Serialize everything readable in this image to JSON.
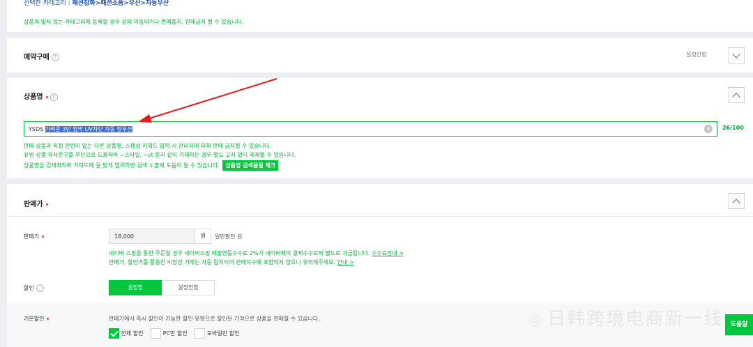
{
  "category": {
    "label": "선택한 카테고리 :",
    "path": "패션잡화>패션소품>우산>자동우산",
    "notice": "상품과 맞지 않는 카테고리에 등록할 경우 강제 이동되거나 판매중지, 판매금지 될 수 있습니다."
  },
  "reservation": {
    "title": "예약구매",
    "status": "설정안함"
  },
  "product_name": {
    "title": "상품명",
    "prefix": "YSDS",
    "highlighted": "가벼운 3단 암막 UV차단 자동 양우산",
    "counter": "26/100",
    "help1": "판매 상품과 직접 관련이 없는 다른 상품명, 스팸성 키워드 입력 시 관리자에 의해 판매 금지될 수 있습니다.",
    "help2": "유명 상품 유사문구를 무단으로 도용하여 ~스타일, ~st 등과 같이 기재하는 경우 별도 고지 없이 제재될 수 있습니다.",
    "help3": "상품명을 검색최적화 가이드에 잘 맞게 입력하면 검색 노출에 도움이 될 수 있습니다.",
    "check_button": "상품명 검색품질 체크"
  },
  "price": {
    "title": "판매가",
    "row_label": "판매가",
    "value": "18,000",
    "unit": "원",
    "reading": "일만팔천 원",
    "note1": "네이버 쇼핑을 통한 주문일 경우 네이버쇼핑 매출연동수수료 2%가 네이버페이 결제수수료와 별도로 과금됩니다.",
    "note1_link": "수수료안내 >",
    "note2": "판매가, 할인가를 활용한 비정상 거래는 자동 탐지되어 판매지수에 포함되지 않으니 유의해주세요.",
    "note2_link": "안내 >",
    "discount_label": "할인",
    "discount_on": "설정함",
    "discount_off": "설정안함",
    "base_discount_label": "기본할인",
    "base_discount_note": "판매가에서 즉시 할인이 가능한 할인 유형으로 할인된 가격으로 상품을 판매할 수 있습니다.",
    "options": [
      "전체 할인",
      "PC만 할인",
      "모바일만 할인"
    ]
  },
  "watermark": "日韩跨境电商新一线",
  "help_button": "도움말",
  "colors": {
    "accent": "#00c73c",
    "link": "#1a4db8",
    "required": "#f03d3d"
  }
}
